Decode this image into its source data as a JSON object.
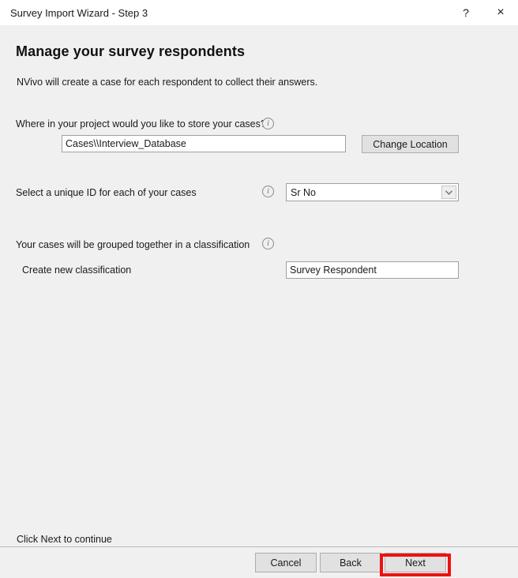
{
  "window": {
    "title": "Survey Import Wizard - Step 3",
    "help_glyph": "?",
    "close_glyph": "×"
  },
  "page": {
    "heading": "Manage your survey respondents",
    "subtext": "NVivo will create a case for each respondent to collect their answers."
  },
  "fields": {
    "location": {
      "label": "Where in your project would you like to store your cases?",
      "info_glyph": "i",
      "value": "Cases\\\\Interview_Database",
      "placeholder": "",
      "button_label": "Change Location"
    },
    "unique_id": {
      "label": "Select a unique ID for each of your cases",
      "info_glyph": "i",
      "selected": "Sr No"
    },
    "classification": {
      "label": "Your cases will be grouped together in a classification",
      "info_glyph": "i",
      "sub_label": "Create new classification",
      "value": "Survey Respondent",
      "placeholder": ""
    }
  },
  "footer": {
    "status": "Click Next to continue",
    "cancel_label": "Cancel",
    "back_label": "Back",
    "next_label": "Next"
  },
  "colors": {
    "highlight": "#ee1111",
    "window_bg": "#f0f0f0",
    "titlebar_bg": "#ffffff"
  }
}
